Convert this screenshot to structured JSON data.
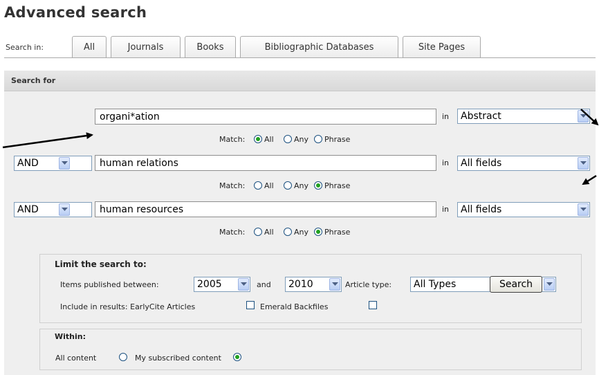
{
  "page": {
    "title": "Advanced search"
  },
  "tabs": {
    "search_in_label": "Search in:",
    "items": [
      "All",
      "Journals",
      "Books",
      "Bibliographic Databases",
      "Site Pages"
    ]
  },
  "panel": {
    "header": "Search for"
  },
  "rows": [
    {
      "operator": "",
      "term": "organi*ation",
      "in_label": "in",
      "field": "Abstract",
      "match_label": "Match:",
      "match_options": [
        "All",
        "Any",
        "Phrase"
      ],
      "match_selected": "All"
    },
    {
      "operator": "AND",
      "term": "human relations",
      "in_label": "in",
      "field": "All fields",
      "match_label": "Match:",
      "match_options": [
        "All",
        "Any",
        "Phrase"
      ],
      "match_selected": "Phrase"
    },
    {
      "operator": "AND",
      "term": "human resources",
      "in_label": "in",
      "field": "All fields",
      "match_label": "Match:",
      "match_options": [
        "All",
        "Any",
        "Phrase"
      ],
      "match_selected": "Phrase"
    }
  ],
  "limit": {
    "title": "Limit the search to:",
    "published_label": "Items published between:",
    "year_from": "2005",
    "and_label": "and",
    "year_to": "2010",
    "article_type_label": "Article type:",
    "article_type": "All Types",
    "include_label": "Include in results: EarlyCite Articles",
    "backfiles_label": "Emerald Backfiles",
    "earlycite_checked": false,
    "backfiles_checked": false
  },
  "within": {
    "title": "Within:",
    "all_content_label": "All content",
    "subscribed_label": "My subscribed content",
    "selected": "My subscribed content"
  },
  "search_button": "Search",
  "colors": {
    "radio_selected": "#21a121",
    "arrow": "#000000"
  },
  "annotations": {
    "type": "arrow",
    "count": 3
  }
}
